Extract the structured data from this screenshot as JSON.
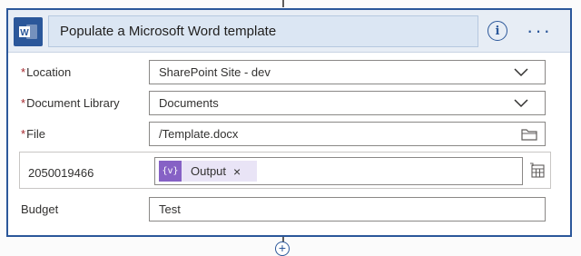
{
  "action": {
    "title": "Populate a Microsoft Word template",
    "icon": "word-icon",
    "info_glyph": "i",
    "more_glyph": "···"
  },
  "fields": {
    "location": {
      "label": "Location",
      "required_mark": "*",
      "value": "SharePoint Site - dev"
    },
    "library": {
      "label": "Document Library",
      "required_mark": "*",
      "value": "Documents"
    },
    "file": {
      "label": "File",
      "required_mark": "*",
      "value": "/Template.docx"
    },
    "dynamic": {
      "label": "2050019466",
      "token": {
        "icon_text": "{v}",
        "label": "Output",
        "remove": "×"
      }
    },
    "budget": {
      "label": "Budget",
      "value": "Test"
    }
  },
  "add_step_glyph": "+",
  "colors": {
    "accent": "#2b579a",
    "token": "#8661c5",
    "required": "#a4262c"
  }
}
